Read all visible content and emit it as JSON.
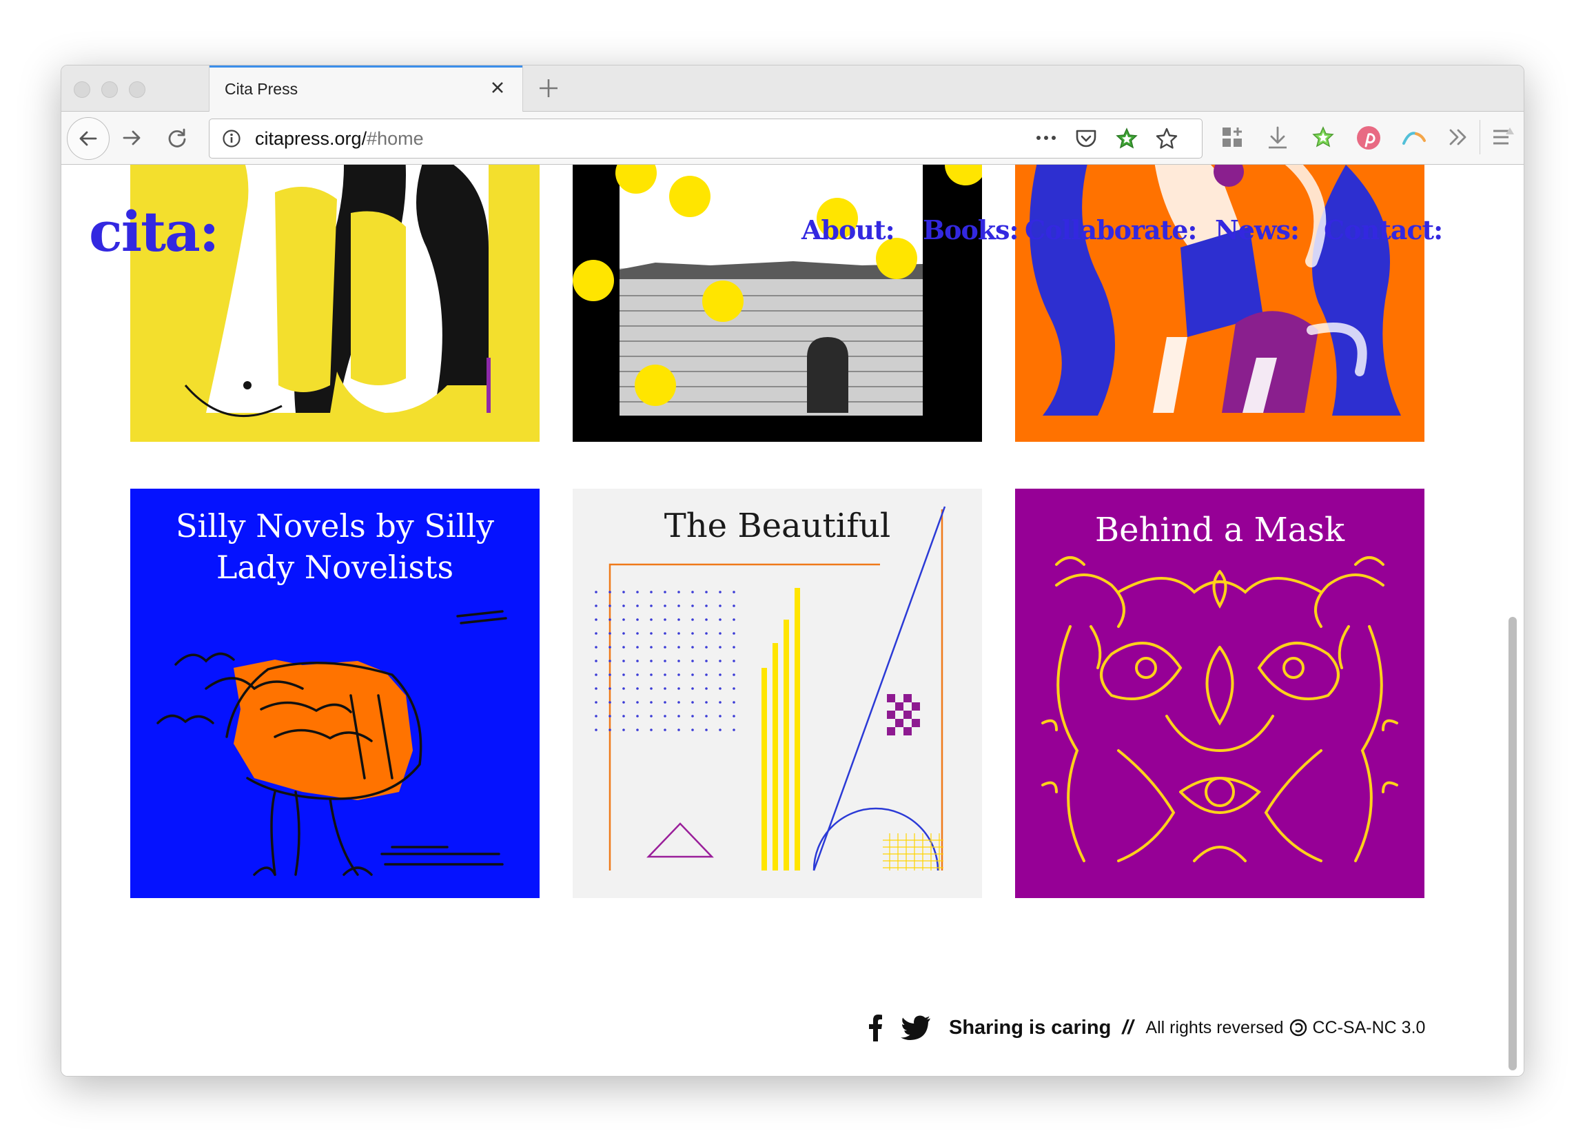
{
  "browser": {
    "tab_title": "Cita Press",
    "url_domain": "citapress.org/",
    "url_path": "#home"
  },
  "site": {
    "logo": "cita:",
    "nav": [
      "About:",
      "Books:",
      "Collaborate:",
      "News:",
      "Contact:"
    ],
    "accent_color": "#3328e0"
  },
  "books": [
    {
      "title": "Silly Novels by Silly Lady Novelists",
      "title_line1": "Silly Novels by Silly",
      "title_line2": "Lady Novelists",
      "bg": "#0512ff"
    },
    {
      "title": "The Beautiful",
      "bg": "#f2f2f2"
    },
    {
      "title": "Behind a Mask",
      "bg": "#960096"
    }
  ],
  "footer": {
    "sharing": "Sharing is caring",
    "separator": "//",
    "rights": "All rights reversed",
    "license": "CC-SA-NC 3.0",
    "icons": [
      "facebook-icon",
      "twitter-icon",
      "copyleft-icon"
    ]
  }
}
